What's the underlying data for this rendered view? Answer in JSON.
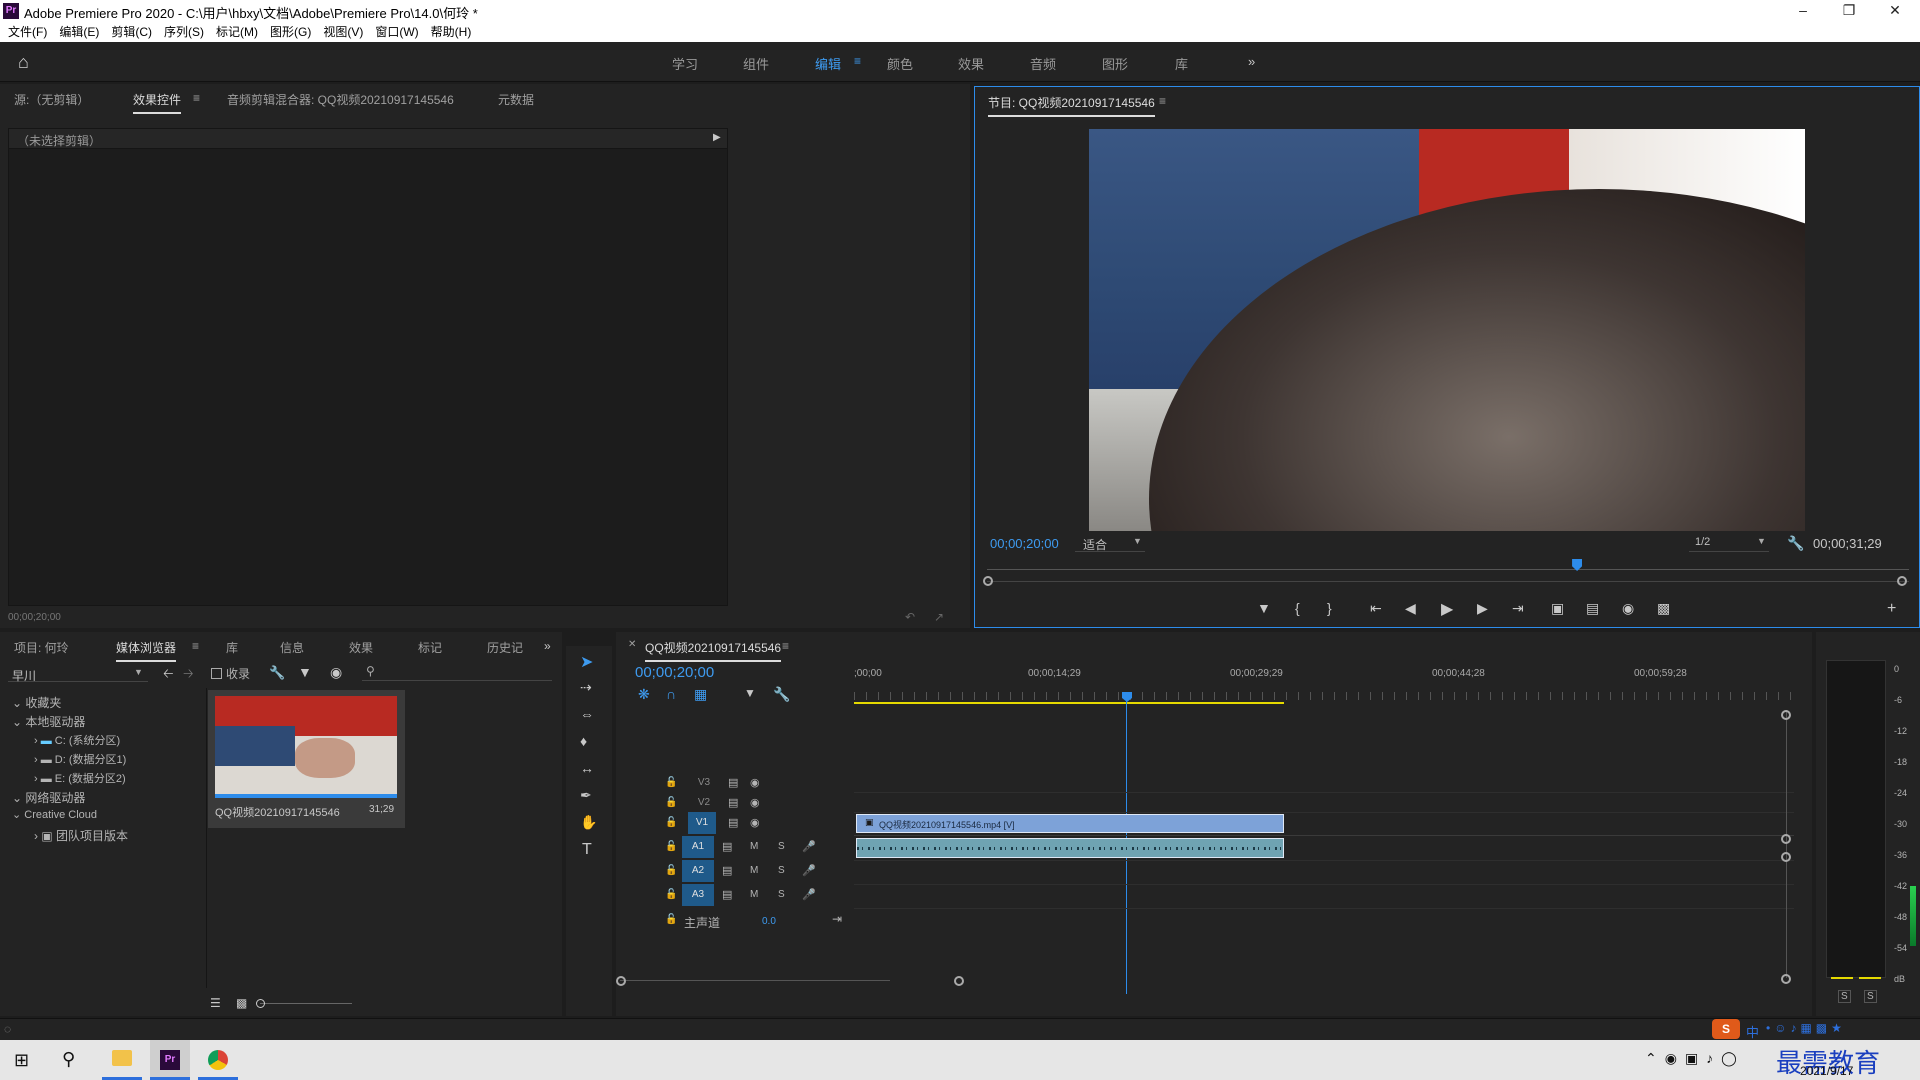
{
  "window": {
    "title": "Adobe Premiere Pro 2020 - C:\\用户\\hbxy\\文档\\Adobe\\Premiere Pro\\14.0\\何玲 *",
    "app_icon": "Pr"
  },
  "menu": [
    "文件(F)",
    "编辑(E)",
    "剪辑(C)",
    "序列(S)",
    "标记(M)",
    "图形(G)",
    "视图(V)",
    "窗口(W)",
    "帮助(H)"
  ],
  "workspaces": {
    "tabs": [
      "学习",
      "组件",
      "编辑",
      "颜色",
      "效果",
      "音频",
      "图形",
      "库"
    ],
    "active": "编辑",
    "more": "»"
  },
  "source_panel": {
    "tabs": [
      "源:（无剪辑）",
      "效果控件",
      "音频剪辑混合器: QQ视频20210917145546",
      "元数据"
    ],
    "active_tab": "效果控件",
    "no_clip": "（未选择剪辑）",
    "timecode": "00;00;20;00"
  },
  "program_monitor": {
    "title": "节目: QQ视频20210917145546",
    "timecode": "00;00;20;00",
    "fit": "适合",
    "resolution": "1/2",
    "duration": "00;00;31;29",
    "playhead_fraction": 0.64
  },
  "project_panel": {
    "tabs": [
      "项目: 何玲",
      "媒体浏览器",
      "库",
      "信息",
      "效果",
      "标记",
      "历史记"
    ],
    "active_tab": "媒体浏览器",
    "location": "早川",
    "ingest_label": "收录",
    "tree": {
      "favorites": "收藏夹",
      "local_drives": "本地驱动器",
      "drives": [
        "C: (系统分区)",
        "D: (数据分区1)",
        "E: (数据分区2)"
      ],
      "network_drives": "网络驱动器",
      "creative_cloud": "Creative Cloud",
      "team_project": "团队项目版本"
    },
    "clip": {
      "name": "QQ视频20210917145546",
      "duration": "31;29"
    }
  },
  "timeline": {
    "sequence_tab": "QQ视频20210917145546",
    "timecode": "00;00;20;00",
    "ruler": [
      ";00;00",
      "00;00;14;29",
      "00;00;29;29",
      "00;00;44;28",
      "00;00;59;28"
    ],
    "video_tracks": [
      "V3",
      "V2",
      "V1"
    ],
    "audio_tracks": [
      "A1",
      "A2",
      "A3"
    ],
    "master_label": "主声道",
    "master_value": "0.0",
    "video_clip": "QQ视频20210917145546.mp4 [V]",
    "mute": "M",
    "solo": "S"
  },
  "audio_meter": {
    "scale": [
      "0",
      "-6",
      "-12",
      "-18",
      "-24",
      "-30",
      "-36",
      "-42",
      "-48",
      "-54",
      "dB"
    ],
    "solo_labels": [
      "S",
      "S"
    ]
  },
  "taskbar": {
    "date": "2021/9/17",
    "ime": "中",
    "watermark": "最需教育"
  }
}
